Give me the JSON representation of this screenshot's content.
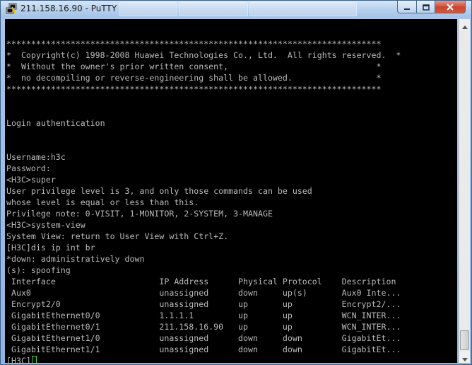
{
  "window": {
    "title": "211.158.16.90 - PuTTY"
  },
  "terminal": {
    "lines": [
      "",
      "****************************************************************************",
      "*  Copyright(c) 1998-2008 Huawei Technologies Co., Ltd.  All rights reserved.  *",
      "*  Without the owner's prior written consent,                              *",
      "*  no decompiling or reverse-engineering shall be allowed.                 *",
      "****************************************************************************",
      "",
      "",
      "Login authentication",
      "",
      "",
      "Username:h3c",
      "Password:",
      "<H3C>super",
      "User privilege level is 3, and only those commands can be used",
      "whose level is equal or less than this.",
      "Privilege note: 0-VISIT, 1-MONITOR, 2-SYSTEM, 3-MANAGE",
      "<H3C>system-view",
      "System View: return to User View with Ctrl+Z.",
      "[H3C]dis ip int br",
      "*down: administratively down",
      "(s): spoofing",
      " Interface                     IP Address      Physical Protocol    Description",
      " Aux0                          unassigned      down     up(s)       Aux0 Inte...",
      " Encrypt2/0                    unassigned      up       up          Encrypt2/...",
      " GigabitEthernet0/0            1.1.1.1         up       up          WCN_INTER...",
      " GigabitEthernet0/1            211.158.16.90   up       up          WCN_INTER...",
      " GigabitEthernet1/0            unassigned      down     down        GigabitEt...",
      " GigabitEthernet1/1            unassigned      down     down        GigabitEt..."
    ],
    "prompt": "[H3C]"
  },
  "colors": {
    "terminal_bg": "#000000",
    "terminal_fg": "#bbbbbb",
    "cursor": "#3fd64b",
    "close_button": "#c9452f"
  },
  "icons": {
    "app": "putty-icon",
    "minimize": "minimize-icon",
    "maximize": "maximize-icon",
    "close": "close-icon",
    "scroll_up": "arrow-up-icon",
    "scroll_down": "arrow-down-icon"
  }
}
